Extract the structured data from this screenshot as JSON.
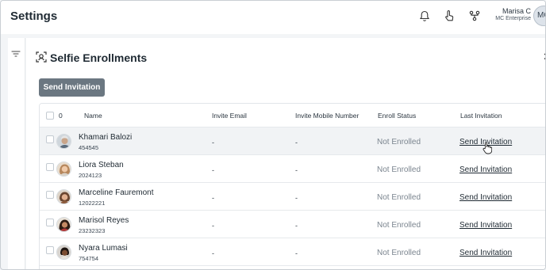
{
  "header": {
    "title": "Settings",
    "icons": [
      "bell-icon",
      "touch-icon",
      "hierarchy-icon"
    ],
    "user": {
      "name": "Marisa C",
      "org": "MC Enterprise",
      "initials": "MC"
    }
  },
  "section": {
    "title": "Selfie Enrollments",
    "send_button": "Send Invitation"
  },
  "table": {
    "selected_count": "0",
    "columns": [
      "Name",
      "Invite Email",
      "Invite Mobile Number",
      "Enroll Status",
      "Last Invitation"
    ],
    "rows": [
      {
        "name": "Khamari Balozi",
        "id": "454545",
        "email": "-",
        "mobile": "-",
        "status": "Not Enrolled",
        "action": "Send Invitation"
      },
      {
        "name": "Liora Steban",
        "id": "2024123",
        "email": "-",
        "mobile": "-",
        "status": "Not Enrolled",
        "action": "Send Invitation"
      },
      {
        "name": "Marceline Fauremont",
        "id": "12022221",
        "email": "-",
        "mobile": "-",
        "status": "Not Enrolled",
        "action": "Send Invitation"
      },
      {
        "name": "Marisol Reyes",
        "id": "23232323",
        "email": "-",
        "mobile": "-",
        "status": "Not Enrolled",
        "action": "Send Invitation"
      },
      {
        "name": "Nyara Lumasi",
        "id": "754754",
        "email": "-",
        "mobile": "-",
        "status": "Not Enrolled",
        "action": "Send Invitation"
      }
    ]
  },
  "colors": {
    "button_bg": "#6b7781",
    "hover_row": "#f1f3f5",
    "status_text": "#7b858f"
  }
}
